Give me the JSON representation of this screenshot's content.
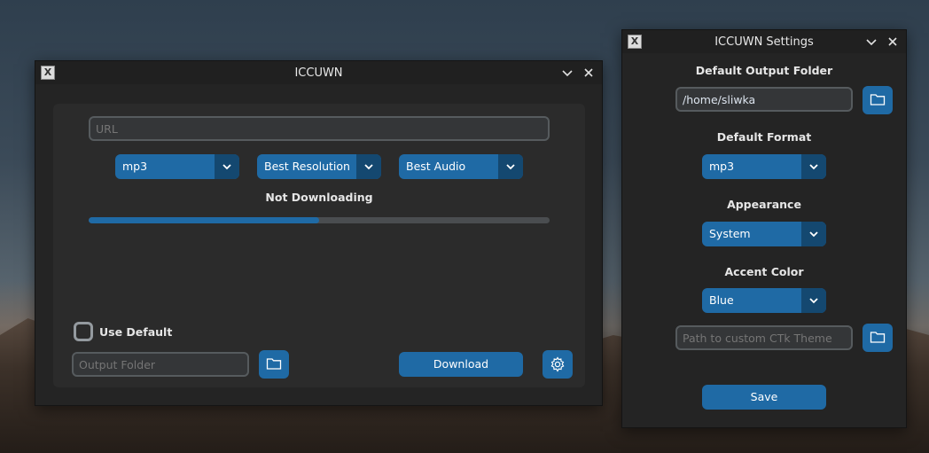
{
  "main_window": {
    "title": "ICCUWN",
    "url_placeholder": "URL",
    "format_dropdown": {
      "value": "mp3"
    },
    "resolution_dropdown": {
      "value": "Best Resolution"
    },
    "audio_dropdown": {
      "value": "Best Audio"
    },
    "status_text": "Not Downloading",
    "progress": 0.5,
    "use_default_label": "Use Default",
    "output_folder_placeholder": "Output Folder",
    "download_label": "Download"
  },
  "settings_window": {
    "title": "ICCUWN Settings",
    "default_output_folder_label": "Default Output Folder",
    "default_output_folder_value": "/home/sliwka",
    "default_format_label": "Default Format",
    "default_format_value": "mp3",
    "appearance_label": "Appearance",
    "appearance_value": "System",
    "accent_color_label": "Accent Color",
    "accent_color_value": "Blue",
    "theme_path_placeholder": "Path to custom CTk Theme",
    "save_label": "Save"
  },
  "colors": {
    "accent": "#1f6aa5",
    "accent_dark": "#144870",
    "window_bg": "#242424"
  },
  "icons": [
    "app-icon",
    "minimize-chevron-icon",
    "close-icon",
    "folder-icon",
    "gear-icon",
    "chevron-down-icon"
  ]
}
